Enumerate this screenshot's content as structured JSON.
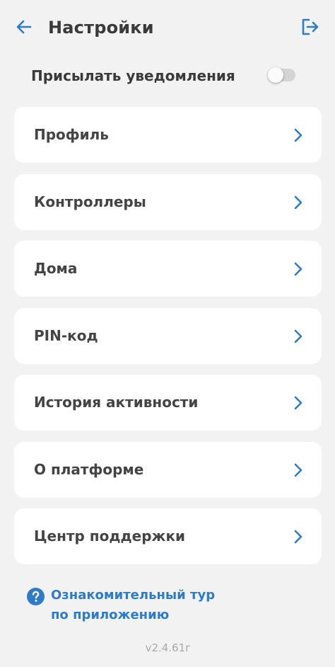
{
  "header": {
    "title": "Настройки",
    "back_icon": "arrow-left-icon",
    "logout_icon": "logout-icon"
  },
  "notifications": {
    "label": "Присылать уведомления",
    "enabled": false
  },
  "menu": {
    "items": [
      {
        "label": "Профиль"
      },
      {
        "label": "Контроллеры"
      },
      {
        "label": "Дома"
      },
      {
        "label": "PIN-код"
      },
      {
        "label": "История активности"
      },
      {
        "label": "О платформе"
      },
      {
        "label": "Центр поддержки"
      }
    ]
  },
  "tour": {
    "line1": "Ознакомительный тур",
    "line2": "по приложению",
    "icon": "help-circle-icon"
  },
  "version": "v2.4.61r",
  "colors": {
    "accent": "#2e7bc9",
    "background": "#f2f2f2",
    "card": "#ffffff",
    "text": "#3a3a3a"
  }
}
